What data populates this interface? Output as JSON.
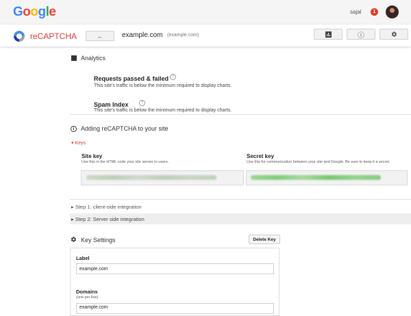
{
  "google": {
    "logo_letters": [
      "G",
      "o",
      "o",
      "g",
      "l",
      "e"
    ],
    "logo_colors": [
      "#4285F4",
      "#EA4335",
      "#FBBC05",
      "#4285F4",
      "#34A853",
      "#EA4335"
    ],
    "user_name": "sajal",
    "notification_count": "1"
  },
  "recaptcha_bar": {
    "brand": "reCAPTCHA",
    "brand_color": "#d93a3a",
    "back_icon": "←",
    "site_name": "example.com",
    "site_sub": "(example.com)",
    "info_icon": "ⓘ"
  },
  "analytics": {
    "title": "Analytics",
    "requests_title": "Requests passed & failed",
    "requests_note": "This site's traffic is below the minimum required to display charts.",
    "spam_title": "Spam Index",
    "spam_note": "This site's traffic is below the minimum required to display charts.",
    "help_glyph": "?"
  },
  "adding": {
    "title": "Adding reCAPTCHA to your site",
    "info_glyph": "i",
    "keys_toggle": "▾ Keys",
    "site_key_label": "Site key",
    "site_key_hint": "Use this in the HTML code your site serves to users.",
    "secret_key_label": "Secret key",
    "secret_key_hint": "Use this for communication between your site and Google. Be sure to keep it a secret.",
    "step1": "▸ Step 1: client-side integration",
    "step2": "▸ Step 2: Server side integration"
  },
  "key_settings": {
    "title": "Key Settings",
    "delete_button": "Delete Key",
    "label_label": "Label",
    "label_value": "example.com",
    "domains_label": "Domains",
    "domains_hint": "(one per line)",
    "domains_value": "example.com"
  }
}
